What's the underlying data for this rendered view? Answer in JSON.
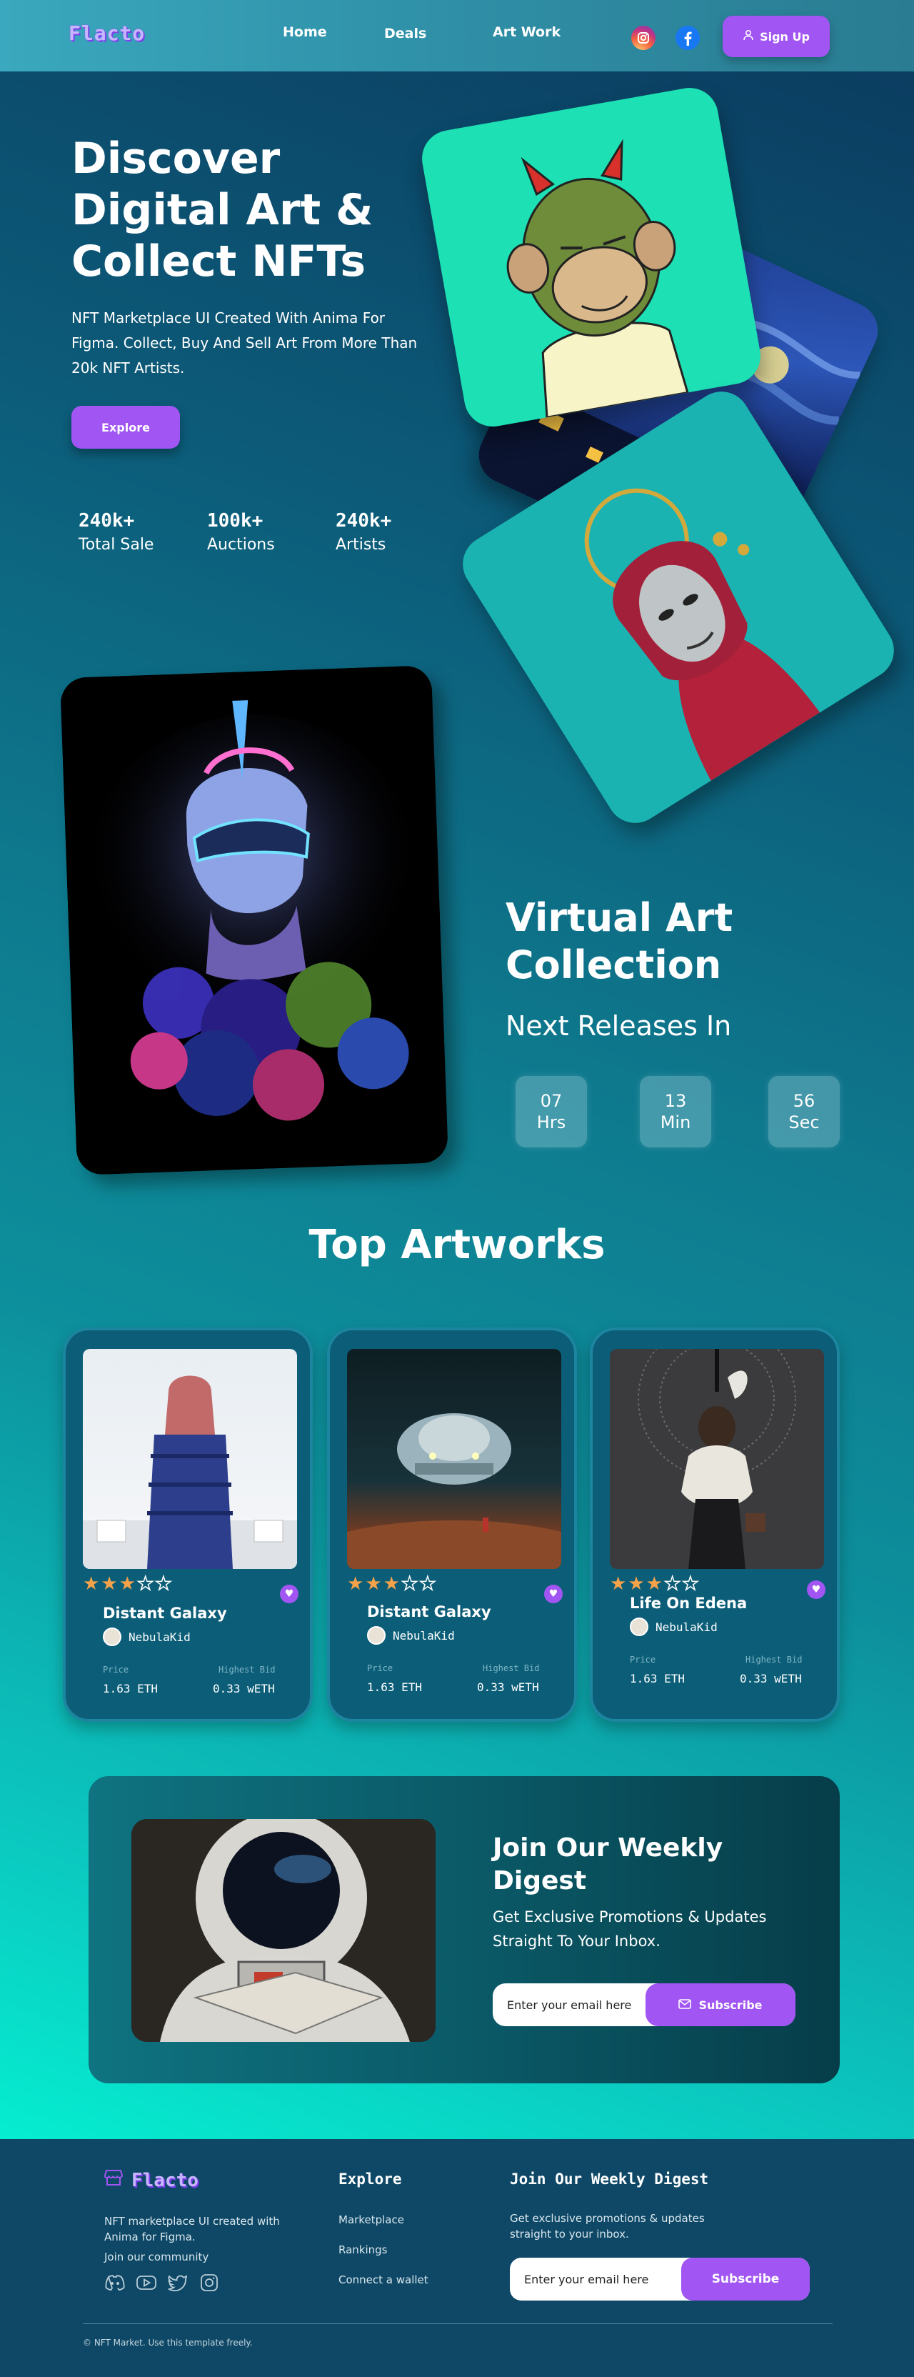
{
  "nav": {
    "logo": "Flacto",
    "links": [
      "Home",
      "Deals",
      "Art Work"
    ],
    "signup_label": "Sign Up"
  },
  "hero": {
    "title": "Discover Digital Art & Collect NFTs",
    "subtitle": "NFT Marketplace UI Created With Anima For Figma. Collect, Buy And Sell Art From More Than 20k NFT Artists.",
    "explore_label": "Explore",
    "stats": [
      {
        "value": "240k+",
        "label": "Total Sale"
      },
      {
        "value": "100k+",
        "label": "Auctions"
      },
      {
        "value": "240k+",
        "label": "Artists"
      }
    ]
  },
  "virtual": {
    "title": "Virtual Art Collection",
    "subtitle": "Next Releases In",
    "timer": [
      {
        "value": "07",
        "unit": "Hrs"
      },
      {
        "value": "13",
        "unit": "Min"
      },
      {
        "value": "56",
        "unit": "Sec"
      }
    ]
  },
  "top_artworks": {
    "title": "Top Artworks",
    "price_label": "Price",
    "bid_label": "Highest Bid",
    "cards": [
      {
        "name": "Distant Galaxy",
        "creator": "NebulaKid",
        "rating": 3,
        "price": "1.63 ETH",
        "bid": "0.33 wETH"
      },
      {
        "name": "Distant Galaxy",
        "creator": "NebulaKid",
        "rating": 3,
        "price": "1.63 ETH",
        "bid": "0.33 wETH"
      },
      {
        "name": "Life On Edena",
        "creator": "NebulaKid",
        "rating": 3,
        "price": "1.63 ETH",
        "bid": "0.33 wETH"
      }
    ]
  },
  "digest": {
    "title": "Join Our Weekly Digest",
    "subtitle": "Get Exclusive Promotions & Updates Straight To Your Inbox.",
    "placeholder": "Enter your email here",
    "button_label": "Subscribe"
  },
  "footer": {
    "logo": "Flacto",
    "about": "NFT marketplace UI created with Anima for Figma.",
    "community": "Join our community",
    "explore_title": "Explore",
    "explore_links": [
      "Marketplace",
      "Rankings",
      "Connect a wallet"
    ],
    "digest_title": "Join Our Weekly Digest",
    "digest_text": "Get exclusive promotions & updates straight to your inbox.",
    "placeholder": "Enter your email here",
    "button_label": "Subscribe",
    "copyright": "© NFT Market. Use this template freely."
  },
  "colors": {
    "accent": "#a155f2",
    "star": "#f5a24a",
    "card_bg": "#0c5e78",
    "footer_bg": "#0e4866"
  }
}
